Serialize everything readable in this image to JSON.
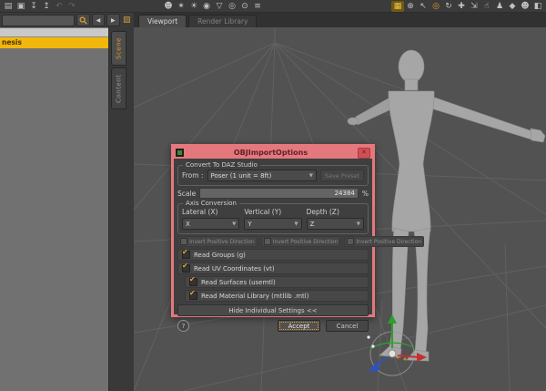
{
  "toolbar": {
    "left": [
      {
        "name": "open-file-icon",
        "glyph": "▤"
      },
      {
        "name": "save-file-icon",
        "glyph": "▣"
      },
      {
        "name": "import-file-icon",
        "glyph": "↧"
      },
      {
        "name": "export-file-icon",
        "glyph": "↥"
      },
      {
        "name": "undo-icon",
        "glyph": "↶"
      },
      {
        "name": "redo-icon",
        "glyph": "↷"
      }
    ],
    "middle": [
      {
        "name": "create-figure-icon",
        "glyph": "☻"
      },
      {
        "name": "animate-icon",
        "glyph": "✶"
      },
      {
        "name": "distant-light-icon",
        "glyph": "☀"
      },
      {
        "name": "point-light-icon",
        "glyph": "◉"
      },
      {
        "name": "spotlight-icon",
        "glyph": "▽"
      },
      {
        "name": "camera-icon",
        "glyph": "◎"
      },
      {
        "name": "render-icon",
        "glyph": "⊙"
      },
      {
        "name": "scene-list-icon",
        "glyph": "≡"
      }
    ],
    "right": [
      {
        "name": "active-viewport-tool-icon",
        "glyph": "▦"
      },
      {
        "name": "orbit-tool-icon",
        "glyph": "⊕"
      },
      {
        "name": "pointer-tool-icon",
        "glyph": "↖"
      },
      {
        "name": "surface-tool-icon",
        "glyph": "◎"
      },
      {
        "name": "rotate-tool-icon",
        "glyph": "↻"
      },
      {
        "name": "translate-tool-icon",
        "glyph": "✚"
      },
      {
        "name": "scale-tool-icon",
        "glyph": "⇲"
      },
      {
        "name": "pose-tool-icon",
        "glyph": "☝"
      },
      {
        "name": "figure-tool-icon",
        "glyph": "♟"
      },
      {
        "name": "primitive-icon",
        "glyph": "◆"
      },
      {
        "name": "person-icon",
        "glyph": "☻"
      },
      {
        "name": "clipped-icon",
        "glyph": "◧"
      }
    ]
  },
  "nav": {
    "back": "◀",
    "forward": "▶",
    "search_value": ""
  },
  "viewport_tabs": [
    {
      "label": "Viewport"
    },
    {
      "label": "Render Library"
    }
  ],
  "sidebar": {
    "selected_item": "nesis",
    "tabs": [
      {
        "label": "Scene"
      },
      {
        "label": "Content"
      }
    ]
  },
  "dialog": {
    "title": "OBJImportOptions",
    "close": "✕",
    "convert_group": {
      "label": "Convert To DAZ Studio",
      "from_label": "From :",
      "from_value": "Poser (1 unit = 8ft)",
      "dropdown_arrow": "▼",
      "preset_button": "Save Preset"
    },
    "scale": {
      "label": "Scale",
      "value": "24384",
      "unit": "%"
    },
    "axis_group": {
      "label": "Axis Conversion",
      "columns": [
        {
          "label": "Lateral (X)",
          "value": "X"
        },
        {
          "label": "Vertical (Y)",
          "value": "Y"
        },
        {
          "label": "Depth (Z)",
          "value": "Z"
        }
      ],
      "invert_label": "Invert Positive Direction"
    },
    "options": [
      {
        "label": "Read Groups (g)",
        "check": "✔"
      },
      {
        "label": "Read UV Coordinates (vt)",
        "check": "✔"
      },
      {
        "label": "Read Surfaces (usemtl)",
        "check": "✔"
      },
      {
        "label": "Read Material Library (mtllib .mtl)",
        "check": "✔"
      }
    ],
    "hide_button": "Hide Individual Settings <<",
    "help_button": "?",
    "accept_button": "Accept",
    "cancel_button": "Cancel"
  }
}
